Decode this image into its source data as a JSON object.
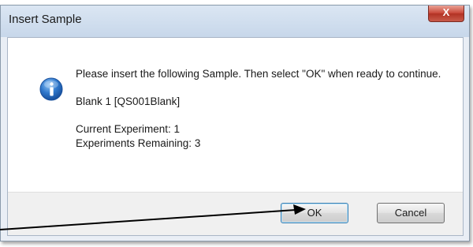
{
  "dialog": {
    "title": "Insert Sample",
    "close_label": "X",
    "message_line1": "Please insert the following Sample. Then select \"OK\" when ready to continue.",
    "sample": "Blank 1 [QS001Blank]",
    "current_experiment": "Current Experiment: 1",
    "experiments_remaining": "Experiments Remaining: 3",
    "icon": "information-icon"
  },
  "buttons": {
    "ok_label": "OK",
    "cancel_label": "Cancel"
  },
  "colors": {
    "accent": "#3c7fb1",
    "close_red": "#c9483a",
    "info_blue": "#1f5fb2"
  }
}
